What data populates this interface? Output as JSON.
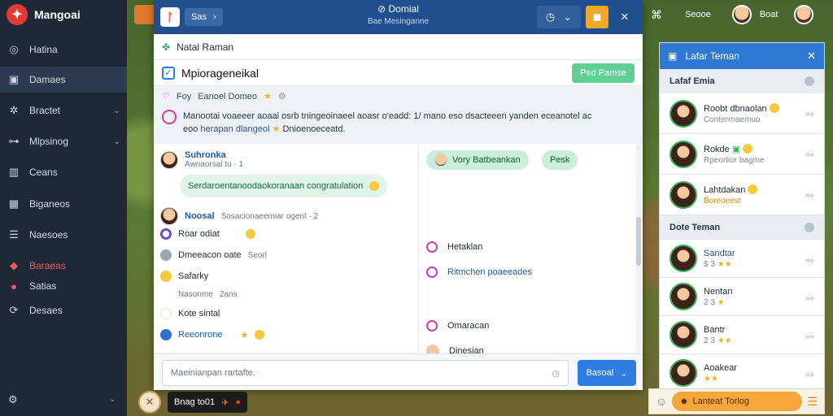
{
  "colors": {
    "accent": "#2f79d6",
    "sidebar": "#1e2836",
    "green": "#5fcf95",
    "orange": "#f6a63a"
  },
  "sidebar": {
    "brand": "Mangoai",
    "items": [
      {
        "label": "Hatina",
        "icon": "compass-icon"
      },
      {
        "label": "Damaes",
        "icon": "inbox-icon"
      },
      {
        "label": "Bractet",
        "icon": "bug-icon"
      },
      {
        "label": "Mlpsinog",
        "icon": "ticket-icon"
      },
      {
        "label": "Ceans",
        "icon": "chart-icon"
      },
      {
        "label": "Biganeos",
        "icon": "grid-icon"
      },
      {
        "label": "Naesoes",
        "icon": "list-icon"
      },
      {
        "label": "Baraeas",
        "icon": "game-icon"
      },
      {
        "label": "Satias",
        "icon": "flag-icon"
      },
      {
        "label": "Desaes",
        "icon": "refresh-icon"
      }
    ]
  },
  "window": {
    "tab_label": "Sas",
    "title": "Domial",
    "subtitle": "Bae Mesinganne",
    "section_label": "Natal Raman",
    "header_title": "Mpiorageneikal",
    "header_button": "Ped Pamse",
    "info": {
      "author": "Foy",
      "meta": "Eanoel Domeo",
      "body_line1": "Manootai voaeeer aoaai osrb tningeoinaeel aoasr o'eadd: 1/ mano eso dsacteeen yanden eceanotel ac",
      "body_line2_a": "eoo",
      "body_line2_b": "herapan dlangeol",
      "body_line2_c": "Dnioenoeceatd."
    },
    "messages": [
      {
        "name": "Suhronka",
        "meta": "Awnaorsal tu  ·  1"
      },
      {
        "bubble": "Serdaroentanoodaokoranaan congratulation"
      },
      {
        "name": "Noosal",
        "meta": "Sosacionaeemiar ogent  ·  2"
      },
      {
        "label": "Roar odiat"
      },
      {
        "label": "Dmeeacon oate",
        "meta": "Seorl"
      },
      {
        "label": "Safarky"
      },
      {
        "label": "Nasonme",
        "meta": "2ans"
      },
      {
        "label": "Kote sintal"
      },
      {
        "label": "Reeonrone"
      }
    ],
    "right_col": {
      "pill1": "Vory Batbeankan",
      "pill2": "Pesk",
      "items": [
        {
          "label": "Hetaklan"
        },
        {
          "label": "Ritmchen poaeeades"
        },
        {
          "label": "Omaracan"
        },
        {
          "label": "Dinesian"
        }
      ]
    },
    "composer": {
      "placeholder": "Maeinianpan rartafte.",
      "send_label": "Basoal"
    }
  },
  "topbar": {
    "left_name": "Seooe",
    "right_name": "Boat"
  },
  "friends": {
    "title": "Lafar Teman",
    "section1": "Lafaf Emia",
    "section2": "Dote Teman",
    "online": [
      {
        "name": "Roobt dbnaolan",
        "status": "Conterrnaemuo"
      },
      {
        "name": "Rokde",
        "status": "Rpeortior bagme"
      },
      {
        "name": "Lahtdakan",
        "status": "Boreoeest"
      }
    ],
    "others": [
      {
        "name": "Sandtar",
        "status": "$ 3"
      },
      {
        "name": "Nentan",
        "status": "2 3"
      },
      {
        "name": "Bantr",
        "status": "2 3"
      },
      {
        "name": "Aoakear",
        "status": ""
      }
    ],
    "footer": "Lanteat Torlog"
  },
  "game_bottom": {
    "label": "Bnag to01"
  }
}
